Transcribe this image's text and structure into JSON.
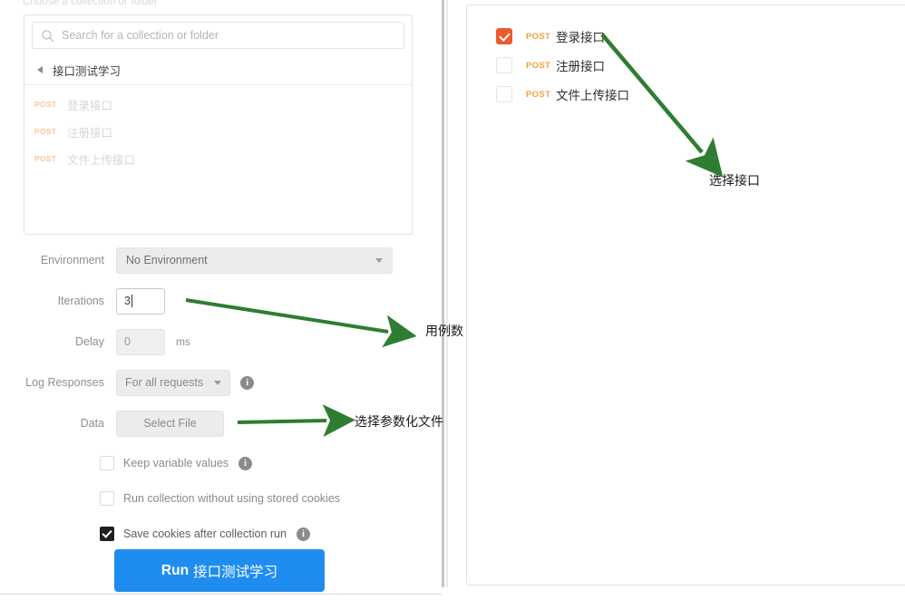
{
  "window": {
    "top_partial_label": "Choose a collection or folder"
  },
  "collection_picker": {
    "search": {
      "placeholder": "Search for a collection or folder",
      "value": "",
      "icon": "search-icon"
    },
    "folder": {
      "name": "接口测试学习",
      "caret_icon": "caret-left-icon",
      "expanded": true
    },
    "requests": [
      {
        "method": "POST",
        "name": "登录接口"
      },
      {
        "method": "POST",
        "name": "注册接口"
      },
      {
        "method": "POST",
        "name": "文件上传接口"
      }
    ]
  },
  "form": {
    "environment": {
      "label": "Environment",
      "value": "No Environment",
      "caret_icon": "chevron-down-icon"
    },
    "iterations": {
      "label": "Iterations",
      "value": "3",
      "focused": true
    },
    "delay": {
      "label": "Delay",
      "value": "0",
      "unit": "ms"
    },
    "log_responses": {
      "label": "Log Responses",
      "value": "For all requests",
      "caret_icon": "chevron-down-icon",
      "info_icon": "info-icon",
      "info_glyph": "i"
    },
    "data": {
      "label": "Data",
      "button_label": "Select File"
    },
    "checkboxes": [
      {
        "label": "Keep variable values",
        "checked": false,
        "has_info": true
      },
      {
        "label": "Run collection without using stored cookies",
        "checked": false,
        "has_info": false
      },
      {
        "label": "Save cookies after collection run",
        "checked": true,
        "has_info": true
      }
    ],
    "run_button": {
      "prefix": "Run",
      "collection": "接口测试学习",
      "color": "#1f8df0"
    }
  },
  "run_order_panel": {
    "requests": [
      {
        "checked": true,
        "method": "POST",
        "name": "登录接口"
      },
      {
        "checked": false,
        "method": "POST",
        "name": "注册接口"
      },
      {
        "checked": false,
        "method": "POST",
        "name": "文件上传接口"
      }
    ],
    "checked_color": "#ec5b2b",
    "method_color": "#f0a13a"
  },
  "annotations": {
    "arrow_color": "#2e7d32",
    "items": [
      {
        "text": "选择接口"
      },
      {
        "text": "用例数"
      },
      {
        "text": "选择参数化文件"
      }
    ]
  }
}
